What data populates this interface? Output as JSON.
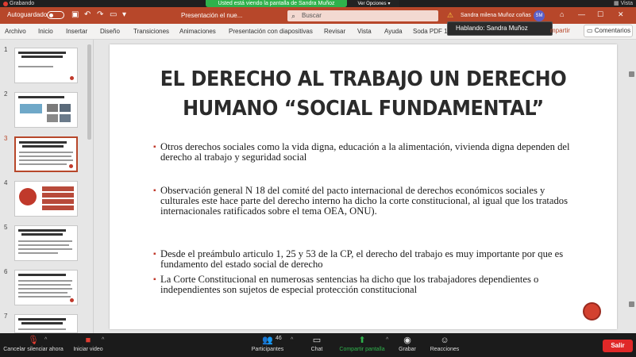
{
  "zoom_banner": {
    "recording_label": "Grabando",
    "share_notice": "Usted está viendo la pantalla de Sandra Muñoz",
    "view_options": "Ver Opciones",
    "view_label": "Vista"
  },
  "titlebar": {
    "autosave_label": "Autoguardado",
    "document_title": "Presentación el nue...",
    "search_placeholder": "Buscar",
    "user_name": "Sandra milena Muñoz coñas",
    "user_initials": "SM"
  },
  "ribbon": {
    "tabs": [
      "Archivo",
      "Inicio",
      "Insertar",
      "Diseño",
      "Transiciones",
      "Animaciones",
      "Presentación con diapositivas",
      "Revisar",
      "Vista",
      "Ayuda",
      "Soda PDF 1"
    ],
    "share_label": "mpartir",
    "comments_label": "Comentarios"
  },
  "speaking_tooltip": "Hablando: Sandra Muñoz",
  "thumbnails": {
    "numbers": [
      "1",
      "2",
      "3",
      "4",
      "5",
      "6",
      "7"
    ],
    "active_index": 3
  },
  "slide": {
    "title_line1": "EL DERECHO AL TRABAJO UN DERECHO",
    "title_line2": "HUMANO “SOCIAL FUNDAMENTAL”",
    "bullets": [
      "Otros derechos sociales como la vida digna, educación a la alimentación, vivienda digna dependen del derecho al trabajo y seguridad social",
      "Observación general N 18 del comité del pacto internacional de derechos económicos sociales y culturales este hace parte del derecho interno ha dicho la corte constitucional, al igual que los tratados internacionales ratificados sobre el tema OEA, ONU).",
      "Desde el preámbulo articulo 1, 25 y 53 de la CP, el derecho del trabajo es muy importante por que es fundamento del estado social de derecho",
      "La Corte Constitucional en numerosas sentencias ha dicho que los trabajadores dependientes o independientes son sujetos de especial protección constitucional"
    ],
    "bullet_color": "#c0392b"
  },
  "zoom_toolbar": {
    "mute_label": "Cancelar silenciar ahora",
    "video_label": "Iniciar video",
    "participants_label": "Participantes",
    "participants_count": "46",
    "chat_label": "Chat",
    "share_label": "Compartir pantalla",
    "record_label": "Grabar",
    "reactions_label": "Reacciones",
    "leave_label": "Salir"
  },
  "colors": {
    "powerpoint_accent": "#b7472a",
    "zoom_green": "#2fb24c",
    "leave_red": "#e02828"
  }
}
